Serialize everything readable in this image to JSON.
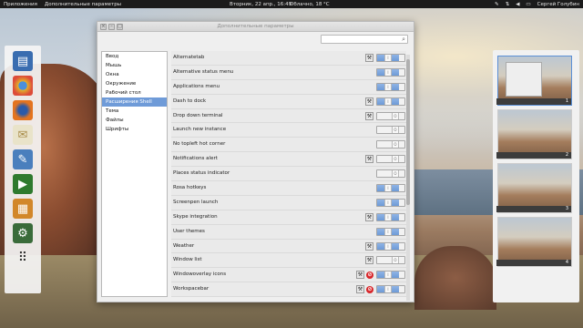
{
  "topbar": {
    "apps_label": "Приложения",
    "active_app": "Дополнительные параметры",
    "clock": "Вторник, 22 апр., 16:49",
    "weather": "Облачно, 18 °C",
    "user": "Сергей Голубин"
  },
  "window": {
    "title": "Дополнительные параметры",
    "search_placeholder": ""
  },
  "sidebar": {
    "items": [
      {
        "label": "Ввод"
      },
      {
        "label": "Мышь"
      },
      {
        "label": "Окна"
      },
      {
        "label": "Окружение"
      },
      {
        "label": "Рабочий стол"
      },
      {
        "label": "Расширения Shell",
        "selected": true
      },
      {
        "label": "Тема"
      },
      {
        "label": "Файлы"
      },
      {
        "label": "Шрифты"
      }
    ]
  },
  "extensions": [
    {
      "name": "Alternatetab",
      "enabled": true,
      "settings": true,
      "error": false
    },
    {
      "name": "Alternative status menu",
      "enabled": true,
      "settings": false,
      "error": false
    },
    {
      "name": "Applications menu",
      "enabled": true,
      "settings": false,
      "error": false
    },
    {
      "name": "Dash to dock",
      "enabled": true,
      "settings": true,
      "error": false
    },
    {
      "name": "Drop down terminal",
      "enabled": false,
      "settings": true,
      "error": false
    },
    {
      "name": "Launch new instance",
      "enabled": false,
      "settings": false,
      "error": false
    },
    {
      "name": "No topleft hot corner",
      "enabled": false,
      "settings": false,
      "error": false
    },
    {
      "name": "Notifications alert",
      "enabled": false,
      "settings": true,
      "error": false
    },
    {
      "name": "Places status indicator",
      "enabled": false,
      "settings": false,
      "error": false
    },
    {
      "name": "Rosa hotkeys",
      "enabled": true,
      "settings": false,
      "error": false
    },
    {
      "name": "Screenpen launch",
      "enabled": true,
      "settings": false,
      "error": false
    },
    {
      "name": "Skype integration",
      "enabled": true,
      "settings": true,
      "error": false
    },
    {
      "name": "User themes",
      "enabled": true,
      "settings": false,
      "error": false
    },
    {
      "name": "Weather",
      "enabled": true,
      "settings": true,
      "error": false
    },
    {
      "name": "Window list",
      "enabled": false,
      "settings": true,
      "error": false
    },
    {
      "name": "Windowoverlay icons",
      "enabled": true,
      "settings": true,
      "error": true
    },
    {
      "name": "Workspacebar",
      "enabled": true,
      "settings": true,
      "error": true
    }
  ],
  "toggle_on_glyph": "I",
  "toggle_off_glyph": "O",
  "workspaces": [
    "1",
    "2",
    "3",
    "4"
  ],
  "dock_icons": [
    "files-icon",
    "chrome-icon",
    "firefox-icon",
    "mail-icon",
    "notes-icon",
    "video-icon",
    "photos-icon",
    "settings-icon",
    "apps-grid-icon"
  ],
  "colors": {
    "accent": "#6f9bd8",
    "error": "#d8262a"
  }
}
